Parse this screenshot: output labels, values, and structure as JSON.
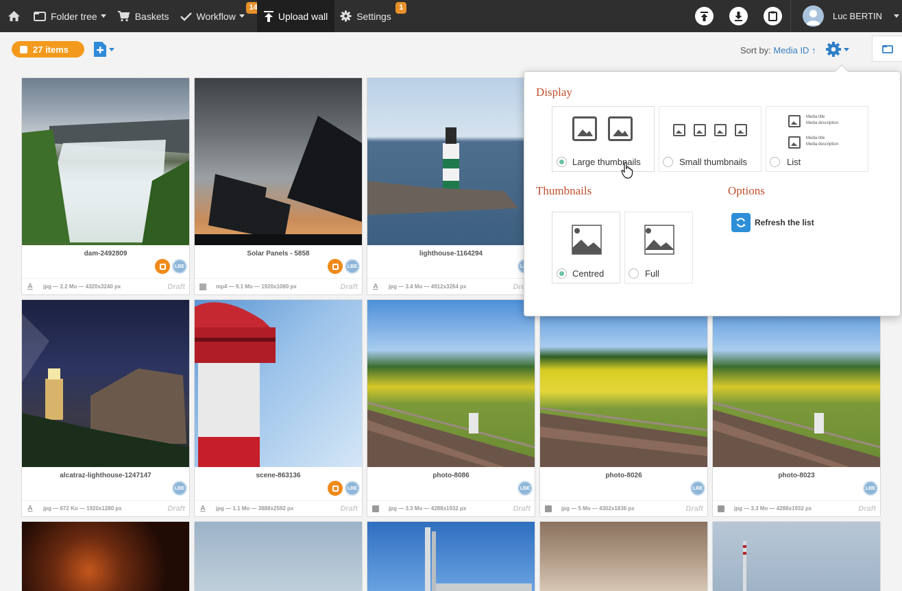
{
  "nav": {
    "folder_tree": "Folder tree",
    "baskets": "Baskets",
    "workflow": "Workflow",
    "workflow_badge": "14",
    "upload_wall": "Upload wall",
    "settings": "Settings",
    "settings_badge": "1",
    "user_name": "Luc BERTIN"
  },
  "toolbar": {
    "items_count": "27 items",
    "sort_label": "Sort by:",
    "sort_value": "Media ID ↑"
  },
  "popover": {
    "display_title": "Display",
    "display_options": [
      "Large thumbnails",
      "Small thumbnails",
      "List"
    ],
    "list_preview": [
      "Media title",
      "Media description"
    ],
    "thumbnails_title": "Thumbnails",
    "thumbnail_options": [
      "Centred",
      "Full"
    ],
    "options_title": "Options",
    "refresh_label": "Refresh the list"
  },
  "media": [
    {
      "name": "dam-2492809",
      "meta": "jpg — 2.2 Mo — 4320x3240 px",
      "status": "Draft",
      "lbe": "LBE"
    },
    {
      "name": "Solar Panels - 5858",
      "meta": "mp4 — 9.1 Mo — 1920x1080 px",
      "status": "Draft",
      "lbe": "LBE"
    },
    {
      "name": "lighthouse-1164294",
      "meta": "jpg — 3.4 Mo — 4912x3264 px",
      "status": "Draft",
      "lbe": "LBE"
    },
    {
      "name": "alcatraz-lighthouse-1247147",
      "meta": "jpg — 672 Ko — 1920x1280 px",
      "status": "Draft",
      "lbe": "LBE"
    },
    {
      "name": "scene-863136",
      "meta": "jpg — 1.1 Mo — 3888x2592 px",
      "status": "Draft",
      "lbe": "LBE"
    },
    {
      "name": "photo-8086",
      "meta": "jpg — 3.3 Mo — 4288x1932 px",
      "status": "Draft",
      "lbe": "LBE"
    },
    {
      "name": "photo-8026",
      "meta": "jpg — 5 Mo — 4302x1836 px",
      "status": "Draft",
      "lbe": "LBE"
    },
    {
      "name": "photo-8023",
      "meta": "jpg — 3.3 Mo — 4288x1932 px",
      "status": "Draft",
      "lbe": "LBE"
    }
  ],
  "colors": {
    "topbar": "#2f2f2f",
    "accent_orange": "#f39a1d",
    "link_blue": "#3a7fc2",
    "section_title": "#c0502d",
    "radio_selected": "#6cc3a6"
  }
}
